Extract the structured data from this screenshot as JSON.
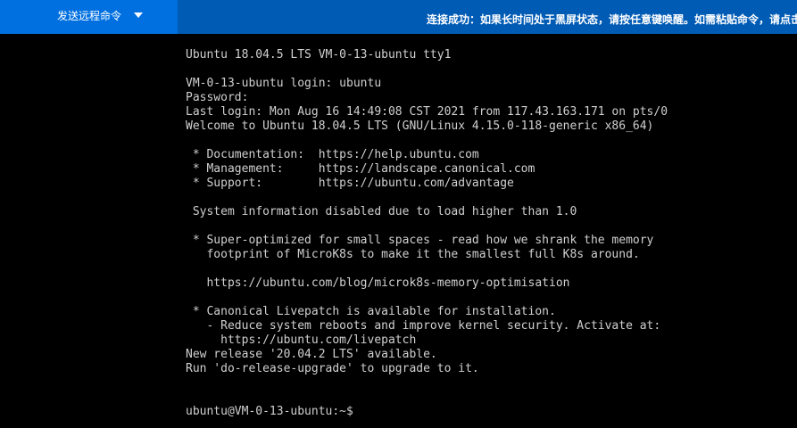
{
  "toolbar": {
    "send_command_label": "发送远程命令",
    "status_message": "连接成功：如果长时间处于黑屏状态，请按任意键唤醒。如需粘贴命令，请点击"
  },
  "terminal": {
    "lines": [
      "Ubuntu 18.04.5 LTS VM-0-13-ubuntu tty1",
      "",
      "VM-0-13-ubuntu login: ubuntu",
      "Password:",
      "Last login: Mon Aug 16 14:49:08 CST 2021 from 117.43.163.171 on pts/0",
      "Welcome to Ubuntu 18.04.5 LTS (GNU/Linux 4.15.0-118-generic x86_64)",
      "",
      " * Documentation:  https://help.ubuntu.com",
      " * Management:     https://landscape.canonical.com",
      " * Support:        https://ubuntu.com/advantage",
      "",
      " System information disabled due to load higher than 1.0",
      "",
      " * Super-optimized for small spaces - read how we shrank the memory",
      "   footprint of MicroK8s to make it the smallest full K8s around.",
      "",
      "   https://ubuntu.com/blog/microk8s-memory-optimisation",
      "",
      " * Canonical Livepatch is available for installation.",
      "   - Reduce system reboots and improve kernel security. Activate at:",
      "     https://ubuntu.com/livepatch",
      "New release '20.04.2 LTS' available.",
      "Run 'do-release-upgrade' to upgrade to it.",
      "",
      "",
      "ubuntu@VM-0-13-ubuntu:~$"
    ]
  }
}
